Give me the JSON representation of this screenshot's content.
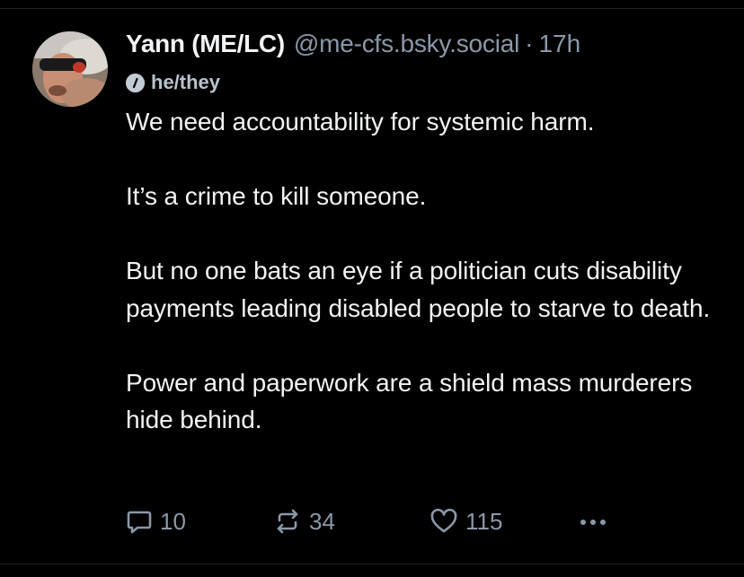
{
  "post": {
    "author": {
      "display_name": "Yann (ME/LC)",
      "handle": "@me-cfs.bsky.social",
      "separator": "·",
      "time": "17h",
      "pronouns": "he/they"
    },
    "text": [
      "We need accountability for systemic harm.",
      "It’s a crime to kill someone.",
      "But no one bats an eye if a politician cuts disability payments leading disabled people to starve to death.",
      "Power and paperwork are a shield mass murderers hide behind."
    ],
    "actions": {
      "reply_count": "10",
      "repost_count": "34",
      "like_count": "115"
    }
  },
  "icons": [
    "reply-icon",
    "repost-icon",
    "heart-icon",
    "more-icon",
    "info-icon"
  ],
  "colors": {
    "background": "#000000",
    "text": "#f1f3f5",
    "muted": "#8b98a8"
  }
}
